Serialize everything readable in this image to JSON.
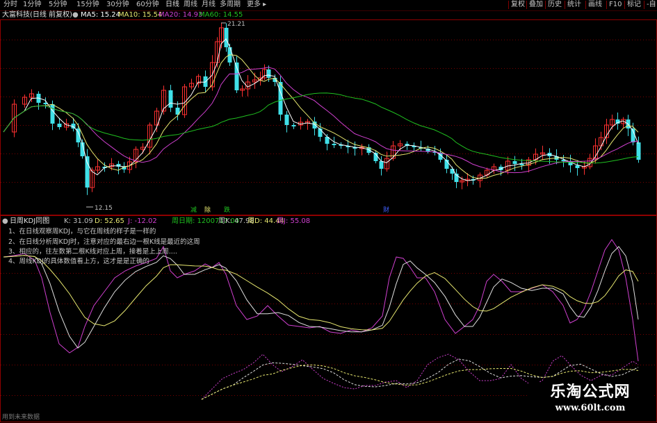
{
  "toolbar": {
    "periods": [
      "分时",
      "1分钟",
      "5分钟",
      "15分钟",
      "30分钟",
      "60分钟",
      "日线",
      "周线",
      "月线",
      "多周期",
      "更多 ▸"
    ],
    "active_period": "日线",
    "right_buttons": [
      "复权",
      "叠加",
      "历史",
      "统计",
      "画线",
      "F10",
      "标记",
      "-自"
    ]
  },
  "main_panel": {
    "title": "大富科技(日线 前复权)",
    "ma": [
      {
        "label": "MA5: 15.24",
        "color": "#ffffff"
      },
      {
        "label": "MA10: 15.54",
        "color": "#e8e870"
      },
      {
        "label": "MA20: 14.93",
        "color": "#d040d0"
      },
      {
        "label": "MA60: 14.55",
        "color": "#20c020"
      }
    ],
    "high_label": "21.21",
    "low_label": "12.15",
    "markers": [
      {
        "text": "减",
        "color": "#20c020"
      },
      {
        "text": "除",
        "color": "#e8e870"
      },
      {
        "text": "跌",
        "color": "#20c020"
      },
      {
        "text": "财",
        "color": "#4060ff"
      }
    ]
  },
  "kdj_panel": {
    "title": "日周KDJ同图",
    "values": [
      {
        "label": "K: 31.09",
        "color": "#c0c0c0"
      },
      {
        "label": "D: 52.65",
        "color": "#e8e870"
      },
      {
        "label": "J: -12.02",
        "color": "#d040d0"
      },
      {
        "label": "周日期: 1200717.00",
        "color": "#20c020"
      },
      {
        "label": "周K: 47.98",
        "color": "#c0c0c0"
      },
      {
        "label": "周D: 44.44",
        "color": "#e8e870"
      },
      {
        "label": "周J: 55.08",
        "color": "#d040d0"
      }
    ],
    "notes": [
      "1、在日线观察周KDJ，与它在周线的样子是一样的",
      "2、在日线分析周KDJ时，注意对应的最右边一根K线是最近的这周",
      "3、相应的，往左数第二根K线对应上周，接着是上上周....",
      "4、周线KDJ的具体数值看上方，这才是是正确的"
    ]
  },
  "watermark": {
    "cn": "乐淘公式网",
    "url": "www.60lt.com"
  },
  "bottom_hint": "用到未来数据",
  "colors": {
    "up": "#ff3030",
    "down": "#40e0e8",
    "grid": "#7a0000",
    "frame": "#900000"
  }
}
